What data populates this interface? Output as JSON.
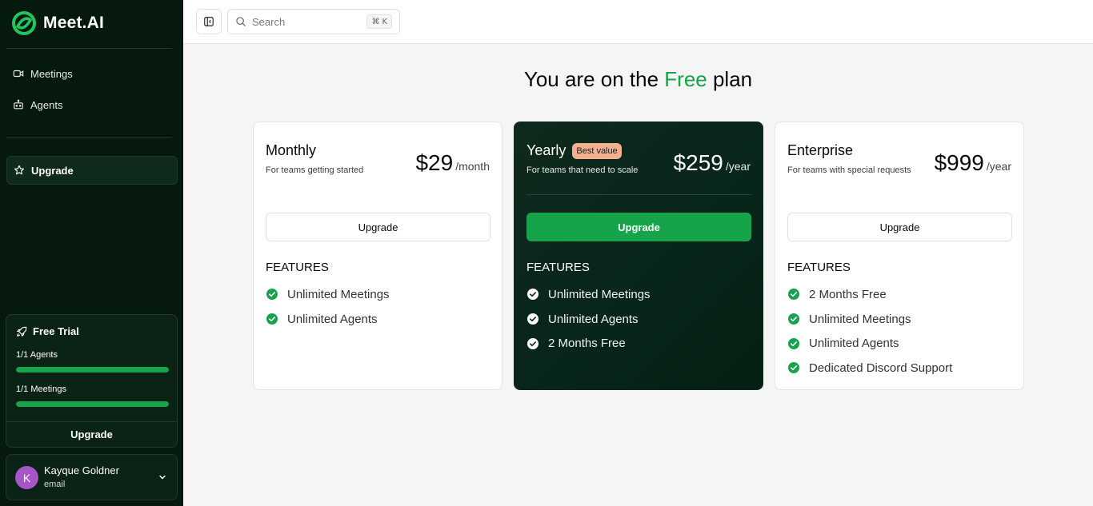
{
  "app": {
    "brand": "Meet.AI"
  },
  "sidebar": {
    "nav": [
      {
        "label": "Meetings",
        "icon": "video-icon"
      },
      {
        "label": "Agents",
        "icon": "bot-icon"
      }
    ],
    "upgrade": {
      "label": "Upgrade",
      "icon": "star-icon"
    },
    "trial": {
      "title": "Free Trial",
      "agents_label": "1/1 Agents",
      "agents_progress": 1.0,
      "meetings_label": "1/1 Meetings",
      "meetings_progress": 1.0,
      "upgrade_label": "Upgrade"
    },
    "user": {
      "initial": "K",
      "name": "Kayque Goldner",
      "email": "email"
    }
  },
  "topbar": {
    "search_placeholder": "Search",
    "shortcut_symbol": "⌘",
    "shortcut_key": "K"
  },
  "page": {
    "title_prefix": "You are on the ",
    "title_plan": "Free",
    "title_suffix": " plan"
  },
  "plans": [
    {
      "name": "Monthly",
      "subtitle": "For teams getting started",
      "price": "$29",
      "period": "/month",
      "button": "Upgrade",
      "features_heading": "FEATURES",
      "features": [
        "Unlimited Meetings",
        "Unlimited Agents"
      ]
    },
    {
      "name": "Yearly",
      "badge": "Best value",
      "subtitle": "For teams that need to scale",
      "price": "$259",
      "period": "/year",
      "button": "Upgrade",
      "features_heading": "FEATURES",
      "features": [
        "Unlimited Meetings",
        "Unlimited Agents",
        "2 Months Free"
      ]
    },
    {
      "name": "Enterprise",
      "subtitle": "For teams with special requests",
      "price": "$999",
      "period": "/year",
      "button": "Upgrade",
      "features_heading": "FEATURES",
      "features": [
        "2 Months Free",
        "Unlimited Meetings",
        "Unlimited Agents",
        "Dedicated Discord Support"
      ]
    }
  ],
  "colors": {
    "sidebar_bg": "#06190f",
    "accent": "#16a34a",
    "badge_bg": "#f5b08f",
    "avatar_bg": "#a855c7"
  }
}
